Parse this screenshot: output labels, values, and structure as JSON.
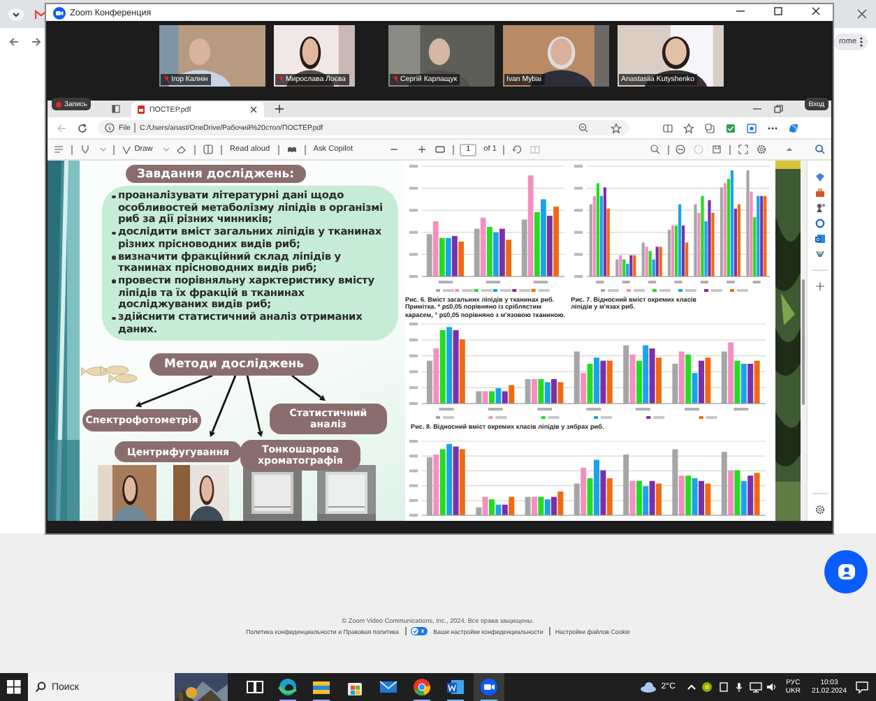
{
  "background_browser": {
    "button_text": "rome"
  },
  "zoom_window": {
    "title": "Zoom Конференция",
    "participants": [
      {
        "name": "Ігор Калнін",
        "muted": true,
        "active_speaker": false
      },
      {
        "name": "Мирослава Лоєва",
        "muted": true,
        "active_speaker": false
      },
      {
        "name": "Сергій Карлащук",
        "muted": true,
        "active_speaker": false
      },
      {
        "name": "Ivan Mybai",
        "muted": false,
        "active_speaker": false
      },
      {
        "name": "Anastasiia Kutyshenko",
        "muted": false,
        "active_speaker": true
      }
    ],
    "recording_badge": "Запись",
    "sign_in_button": "Вход"
  },
  "shared_browser": {
    "tab": {
      "title": "ПОСТЕР.pdf",
      "selected": true
    },
    "address_bar": {
      "scheme_label": "File",
      "url": "C:/Users/anast/OneDrive/Рабочий%20стол/ПОСТЕР.pdf"
    },
    "pdf_toolbar": {
      "draw_button": "Draw",
      "read_aloud_button": "Read aloud",
      "copilot_button": "Ask Copilot",
      "page_number": "1",
      "page_count": "of 1"
    }
  },
  "poster": {
    "tasks_title": "Завдання досліджень:",
    "tasks": [
      "проаналізувати літературні дані щодо особливостей метаболізму ліпідів в організмі риб за дії різних чинників;",
      "дослідити вміст загальних ліпідів у тканинах різних прісноводних видів риб;",
      "визначити фракційний склад ліпідів у тканинах прісноводних видів риб;",
      "провести порівняльну харктеристику вмісту ліпідів та їх фракцій в тканинах досліджуваних видів риб;",
      "здійснити статистичний аналіз отриманих даних."
    ],
    "methods_title": "Методи досліджень",
    "methods": [
      "Спектрофотометрія",
      "Статистичний аналіз",
      "Центрифугування",
      "Тонкошарова хроматографія"
    ],
    "figures": [
      {
        "caption_lines": [
          "Рис. 6. Вміст загальних ліпідів у тканинах риб.",
          "Примітка. * p≤0,05 порівняно із сріблястим",
          "карасем, ° p≤0,05 порівняно з м'язовою тканиною."
        ]
      },
      {
        "caption_lines": [
          "Рис. 7. Відносний вміст окремих класів",
          "ліпідів у м'язах риб."
        ]
      },
      {
        "caption_lines": [
          "Рис. 8. Відносний вміст окремих класів ліпідів у зябрах риб."
        ]
      }
    ]
  },
  "footer": {
    "copyright": "© Zoom Video Communications, Inc., 2024. Все права защищены.",
    "links": [
      "Политика конфиденциальности и Правовая политика",
      "Ваши настройки конфиденциальности",
      "Настройки файлов Cookie"
    ],
    "privacy_toggle": {
      "on": true
    }
  },
  "taskbar": {
    "search_placeholder": "Поиск",
    "apps": [
      {
        "kind": "task-view",
        "running": false,
        "selected": false
      },
      {
        "kind": "edge",
        "running": true,
        "selected": false
      },
      {
        "kind": "explorer",
        "running": true,
        "selected": false
      },
      {
        "kind": "store",
        "running": false,
        "selected": false
      },
      {
        "kind": "mail",
        "running": false,
        "selected": false
      },
      {
        "kind": "chrome",
        "running": true,
        "selected": false
      },
      {
        "kind": "word",
        "running": true,
        "selected": false
      },
      {
        "kind": "zoom",
        "running": true,
        "selected": true
      }
    ],
    "weather": "2°C",
    "language": [
      "РУС",
      "UKR"
    ],
    "time": "10:03",
    "date": "21.02.2024"
  }
}
